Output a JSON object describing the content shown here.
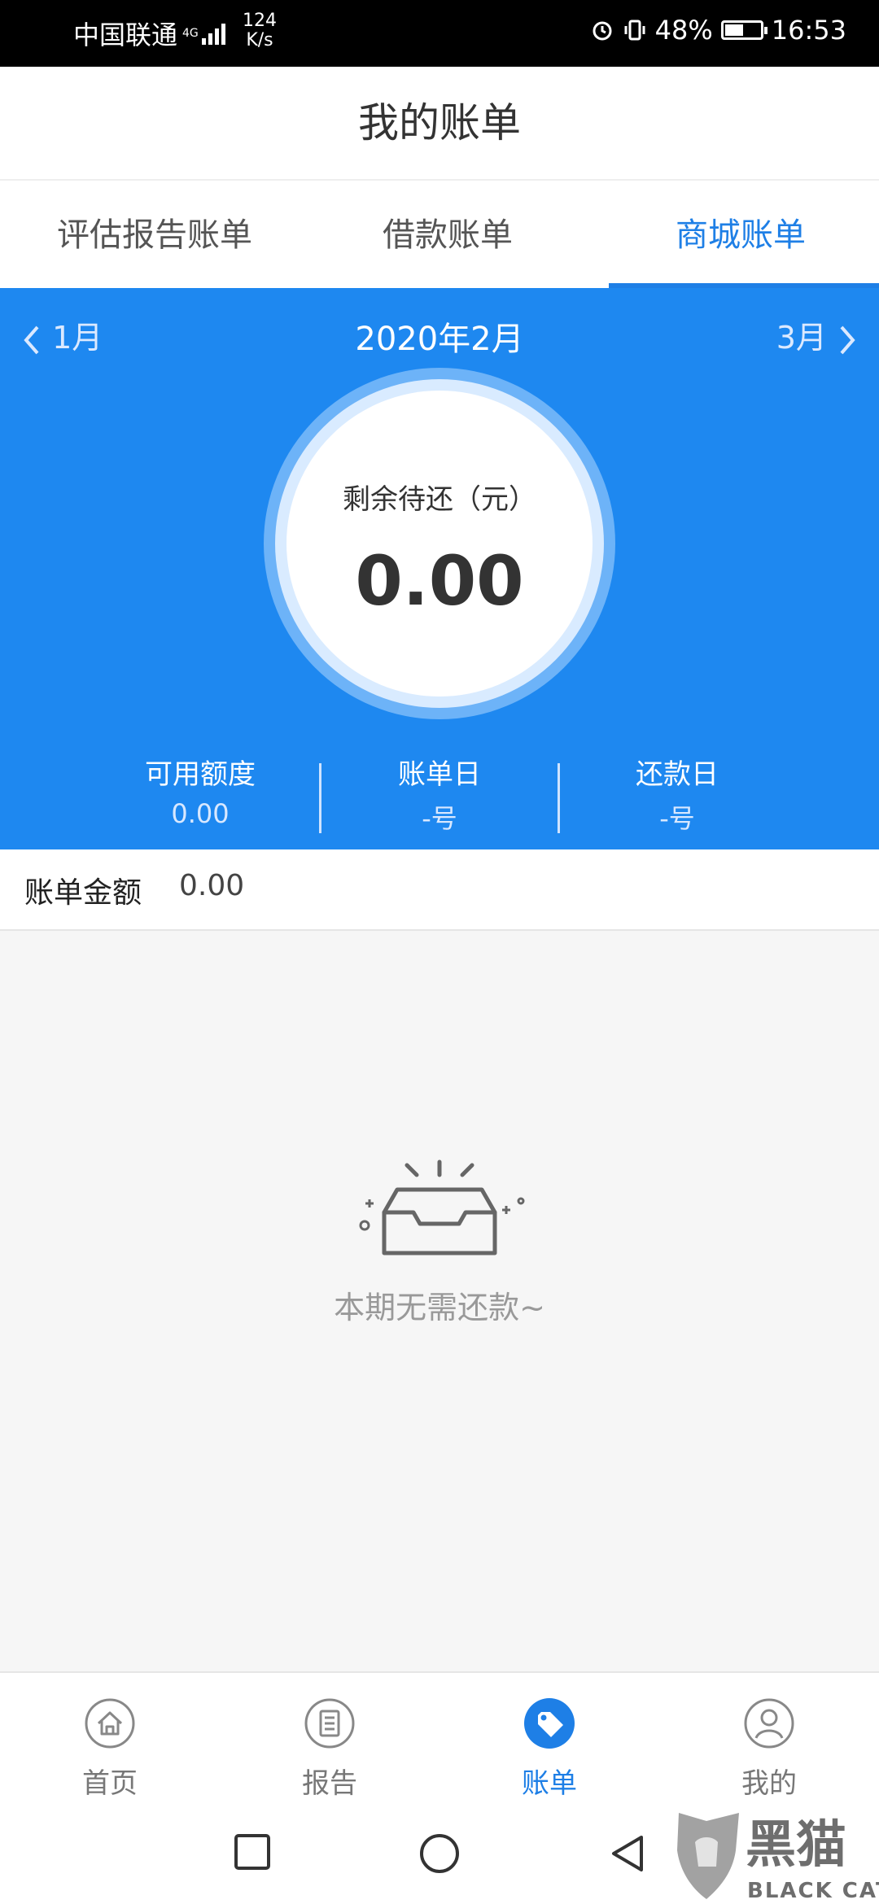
{
  "status_bar": {
    "carrier": "中国联通",
    "network": "4G",
    "speed_value": "124",
    "speed_unit": "K/s",
    "battery": "48%",
    "time": "16:53",
    "icons": [
      "alarm-icon",
      "vibrate-icon",
      "battery-icon"
    ]
  },
  "header": {
    "title": "我的账单"
  },
  "tabs": [
    {
      "label": "评估报告账单",
      "active": false
    },
    {
      "label": "借款账单",
      "active": false
    },
    {
      "label": "商城账单",
      "active": true
    }
  ],
  "month_nav": {
    "prev": "1月",
    "current": "2020年2月",
    "next": "3月"
  },
  "summary": {
    "label": "剩余待还（元）",
    "amount": "0.00"
  },
  "stats": [
    {
      "label": "可用额度",
      "value": "0.00"
    },
    {
      "label": "账单日",
      "value": "-号"
    },
    {
      "label": "还款日",
      "value": "-号"
    }
  ],
  "bill": {
    "label": "账单金额",
    "value": "0.00"
  },
  "empty": {
    "icon": "empty-box-icon",
    "message": "本期无需还款~"
  },
  "bottom_nav": [
    {
      "label": "首页",
      "icon": "home-icon",
      "active": false
    },
    {
      "label": "报告",
      "icon": "report-icon",
      "active": false
    },
    {
      "label": "账单",
      "icon": "tag-icon",
      "active": true
    },
    {
      "label": "我的",
      "icon": "user-icon",
      "active": false
    }
  ],
  "watermark": {
    "text_cn": "黑猫",
    "text_en": "BLACK CAT"
  },
  "colors": {
    "primary": "#1e88f0",
    "accent": "#1e7fe6"
  }
}
